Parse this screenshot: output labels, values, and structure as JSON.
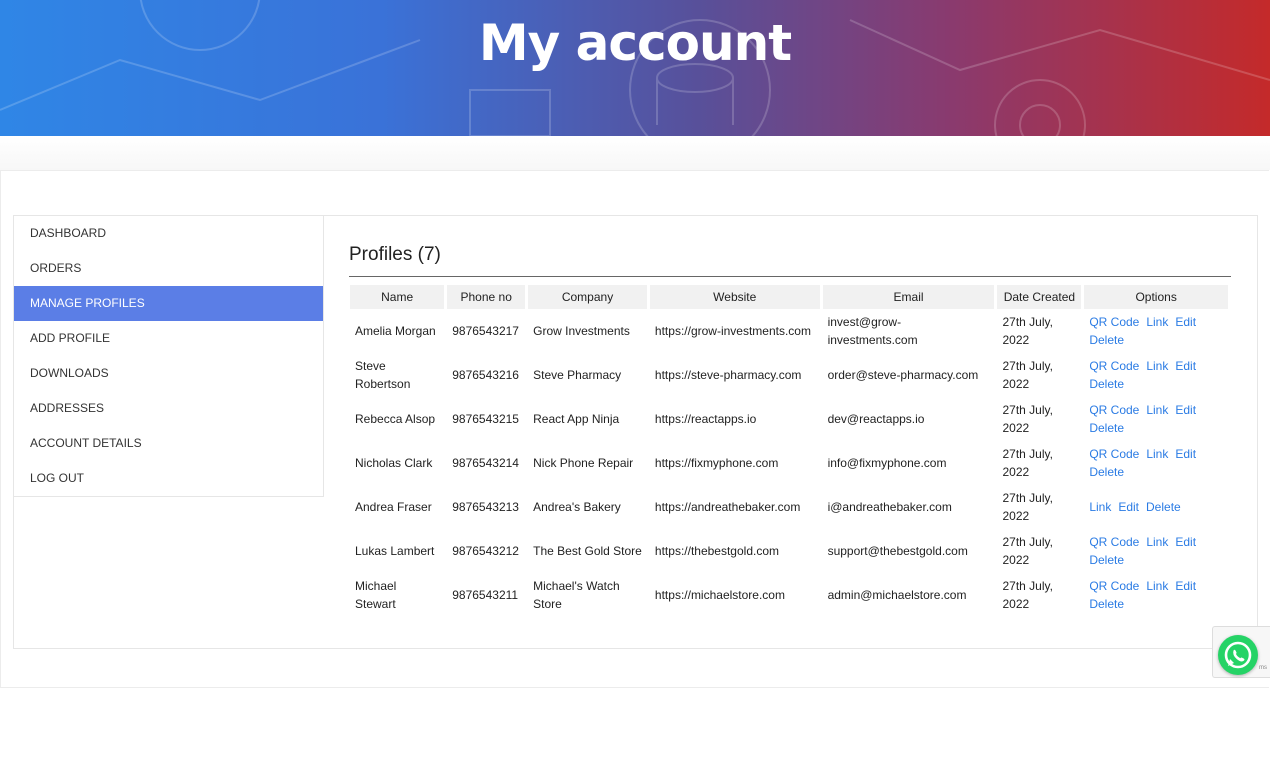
{
  "header": {
    "title": "My account"
  },
  "sidebar": {
    "items": [
      {
        "label": "DASHBOARD"
      },
      {
        "label": "ORDERS"
      },
      {
        "label": "MANAGE PROFILES",
        "active": true
      },
      {
        "label": "ADD PROFILE"
      },
      {
        "label": "DOWNLOADS"
      },
      {
        "label": "ADDRESSES"
      },
      {
        "label": "ACCOUNT DETAILS"
      },
      {
        "label": "LOG OUT"
      }
    ]
  },
  "main": {
    "heading": "Profiles (7)",
    "columns": [
      "Name",
      "Phone no",
      "Company",
      "Website",
      "Email",
      "Date Created",
      "Options"
    ],
    "rows": [
      {
        "name": "Amelia Morgan",
        "phone": "9876543217",
        "company": "Grow Investments",
        "website": "https://grow-investments.com",
        "email": "invest@grow-investments.com",
        "date": "27th July, 2022",
        "options": [
          "QR Code",
          "Link",
          "Edit",
          "Delete"
        ]
      },
      {
        "name": "Steve Robertson",
        "phone": "9876543216",
        "company": "Steve Pharmacy",
        "website": "https://steve-pharmacy.com",
        "email": "order@steve-pharmacy.com",
        "date": "27th July, 2022",
        "options": [
          "QR Code",
          "Link",
          "Edit",
          "Delete"
        ]
      },
      {
        "name": "Rebecca Alsop",
        "phone": "9876543215",
        "company": "React App Ninja",
        "website": "https://reactapps.io",
        "email": "dev@reactapps.io",
        "date": "27th July, 2022",
        "options": [
          "QR Code",
          "Link",
          "Edit",
          "Delete"
        ]
      },
      {
        "name": "Nicholas Clark",
        "phone": "9876543214",
        "company": "Nick Phone Repair",
        "website": "https://fixmyphone.com",
        "email": "info@fixmyphone.com",
        "date": "27th July, 2022",
        "options": [
          "QR Code",
          "Link",
          "Edit",
          "Delete"
        ]
      },
      {
        "name": "Andrea Fraser",
        "phone": "9876543213",
        "company": "Andrea's Bakery",
        "website": "https://andreathebaker.com",
        "email": "i@andreathebaker.com",
        "date": "27th July, 2022",
        "options": [
          "Link",
          "Edit",
          "Delete"
        ]
      },
      {
        "name": "Lukas Lambert",
        "phone": "9876543212",
        "company": "The Best Gold Store",
        "website": "https://thebestgold.com",
        "email": "support@thebestgold.com",
        "date": "27th July, 2022",
        "options": [
          "QR Code",
          "Link",
          "Edit",
          "Delete"
        ]
      },
      {
        "name": "Michael Stewart",
        "phone": "9876543211",
        "company": "Michael's Watch Store",
        "website": "https://michaelstore.com",
        "email": "admin@michaelstore.com",
        "date": "27th July, 2022",
        "options": [
          "QR Code",
          "Link",
          "Edit",
          "Delete"
        ]
      }
    ]
  },
  "widgets": {
    "whatsapp_icon": "whatsapp-icon",
    "recaptcha_badge": "ms"
  },
  "colors": {
    "accent": "#5b7ee6",
    "link": "#2a7be4",
    "header_start": "#2f86e6",
    "header_end": "#c42a2a"
  }
}
